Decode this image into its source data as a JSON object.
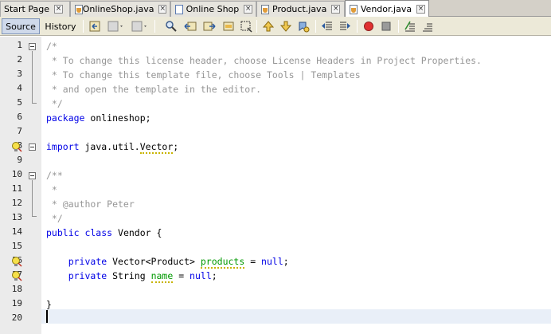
{
  "tabs": [
    {
      "label": "Start Page",
      "icon": "none",
      "active": false
    },
    {
      "label": "OnlineShop.java",
      "icon": "java-file-icon",
      "active": false
    },
    {
      "label": "Online Shop",
      "icon": "project-icon",
      "active": false
    },
    {
      "label": "Product.java",
      "icon": "java-file-icon",
      "active": false
    },
    {
      "label": "Vendor.java",
      "icon": "java-file-icon",
      "active": true
    }
  ],
  "toolbar": {
    "source_label": "Source",
    "history_label": "History"
  },
  "editor": {
    "line_numbers": [
      "1",
      "2",
      "3",
      "4",
      "5",
      "6",
      "7",
      "8",
      "9",
      "10",
      "11",
      "12",
      "13",
      "14",
      "15",
      "16",
      "17",
      "18",
      "19",
      "20"
    ],
    "lines": {
      "l1": "/*",
      "l2": " * To change this license header, choose License Headers in Project Properties.",
      "l3": " * To change this template file, choose Tools | Templates",
      "l4": " * and open the template in the editor.",
      "l5": " */",
      "l6_kw": "package",
      "l6_rest": " onlineshop;",
      "l8_kw": "import",
      "l8_pre": " java.util.",
      "l8_warn": "Vector",
      "l8_post": ";",
      "l10": "/**",
      "l11": " *",
      "l12": " * @author Peter",
      "l13": " */",
      "l14_kw": "public class",
      "l14_rest": " Vendor {",
      "l16_indent": "    ",
      "l16_kw": "private",
      "l16_type": " Vector<Product> ",
      "l16_field": "products",
      "l16_eq": " = ",
      "l16_null": "null",
      "l16_end": ";",
      "l17_indent": "    ",
      "l17_kw": "private",
      "l17_type": " String ",
      "l17_field": "name",
      "l17_eq": " = ",
      "l17_null": "null",
      "l17_end": ";",
      "l19": "}"
    }
  },
  "colors": {
    "keyword": "#0000e6",
    "comment": "#969696",
    "field": "#009900",
    "current_line": "#e9eff8"
  }
}
